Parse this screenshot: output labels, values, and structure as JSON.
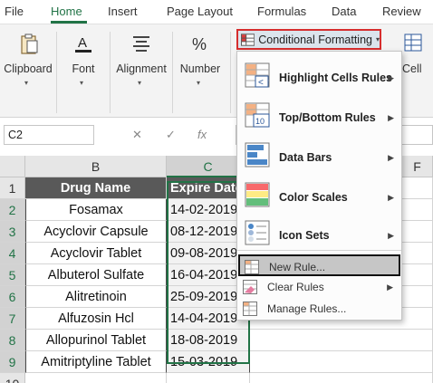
{
  "tabs": [
    "File",
    "Home",
    "Insert",
    "Page Layout",
    "Formulas",
    "Data",
    "Review"
  ],
  "ribbon": {
    "clipboard_label": "Clipboard",
    "font_label": "Font",
    "alignment_label": "Alignment",
    "number_label": "Number",
    "cells_label": "Cell",
    "cf_button_label": "Conditional Formatting"
  },
  "formula_bar": {
    "name_box": "C2",
    "cancel_glyph": "✕",
    "enter_glyph": "✓",
    "fx_glyph": "fx",
    "formula": ""
  },
  "grid": {
    "columns": [
      "B",
      "C",
      "F"
    ],
    "rows": [
      "1",
      "2",
      "3",
      "4",
      "5",
      "6",
      "7",
      "8",
      "9",
      "10"
    ],
    "header_b": "Drug Name",
    "header_c": "Expire Date",
    "drugs": [
      "Fosamax",
      "Acyclovir Capsule",
      "Acyclovir Tablet",
      "Albuterol Sulfate",
      "Alitretinoin",
      "Alfuzosin Hcl",
      "Allopurinol Tablet",
      "Amitriptyline Tablet"
    ],
    "dates": [
      "14-02-2019",
      "08-12-2019",
      "09-08-2019",
      "16-04-2019",
      "25-09-2019",
      "14-04-2019",
      "18-08-2019",
      "15-03-2019"
    ]
  },
  "menu": {
    "items": [
      {
        "label": "Highlight Cells Rules",
        "icon": "highlight-cells-icon"
      },
      {
        "label": "Top/Bottom Rules",
        "icon": "top-bottom-icon"
      },
      {
        "label": "Data Bars",
        "icon": "data-bars-icon"
      },
      {
        "label": "Color Scales",
        "icon": "color-scales-icon"
      },
      {
        "label": "Icon Sets",
        "icon": "icon-sets-icon"
      }
    ],
    "new_rule": "New Rule...",
    "clear_rules": "Clear Rules",
    "manage_rules": "Manage Rules..."
  },
  "colors": {
    "excel_green": "#217346",
    "header_fill": "#595959",
    "cf_outline": "#d62d2d"
  }
}
